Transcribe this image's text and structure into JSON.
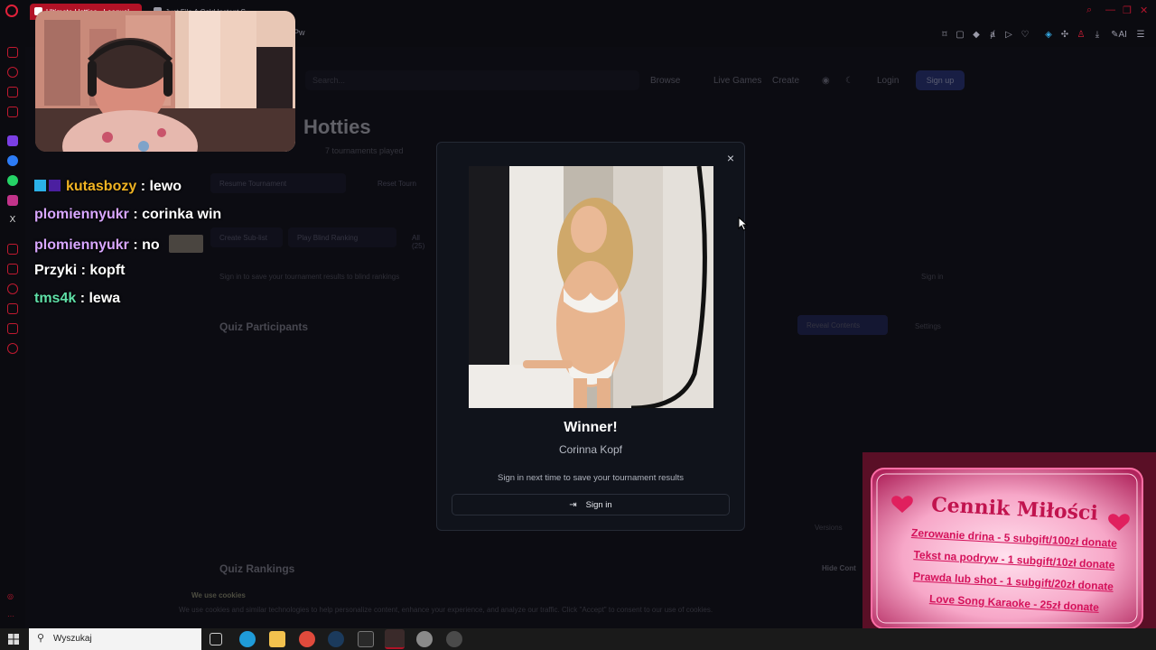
{
  "browser": {
    "tabs": [
      {
        "title": "Ultimate Hotties - Leaguel"
      },
      {
        "title": "Just File A Cold Instant S"
      }
    ],
    "url_fragment": "pPw"
  },
  "site": {
    "search_placeholder": "Search...",
    "nav": {
      "browse": "Browse",
      "live_games": "Live Games",
      "create": "Create",
      "login": "Login",
      "signup": "Sign up"
    },
    "title": "Hotties",
    "subtitle": "7 tournaments played",
    "buttons": {
      "resume": "Resume Tournament",
      "reset": "Reset Tourn",
      "create_list": "Create Sub-list",
      "play_ranking": "Play Blind Ranking",
      "all": "All (25)"
    },
    "signin_hint": "Sign in to save your tournament results to blind rankings",
    "signin_link": "Sign in",
    "sections": {
      "participants": "Quiz Participants",
      "rankings": "Quiz Rankings"
    },
    "reveal_btn": "Reveal Contents",
    "settings": "Settings",
    "hide": "Hide Cont",
    "versions": "Versions",
    "cookie_title": "We use cookies",
    "cookie_text": "We use cookies and similar technologies to help personalize content, enhance your experience, and analyze our traffic. Click \"Accept\" to consent to our use of cookies."
  },
  "modal": {
    "title": "Winner!",
    "name": "Corinna Kopf",
    "note": "Sign in next time to save your tournament results",
    "signin_label": "Sign in"
  },
  "chat": [
    {
      "user": "kutasbozy",
      "message": ": lewo",
      "color": "#f0b323"
    },
    {
      "user": "plomiennyukr",
      "message": ": corinka win",
      "color": "#d8a6ff"
    },
    {
      "user": "plomiennyukr",
      "message": ": no",
      "color": "#d8a6ff"
    },
    {
      "user": "Przyki",
      "message": ": kopft",
      "color": "#ffffff"
    },
    {
      "user": "tms4k",
      "message": ": lewa",
      "color": "#5fe0a8"
    }
  ],
  "pricelist": {
    "title": "Cennik Miłości",
    "items": [
      "Zerowanie drina - 5 subgift/100zł donate",
      "Tekst na podryw - 1 subgift/10zł donate",
      "Prawda lub shot - 1 subgift/20zł donate",
      "Love Song Karaoke - 25zł donate"
    ]
  },
  "taskbar": {
    "search_placeholder": "Wyszukaj"
  },
  "colors": {
    "accent_red": "#b11226",
    "modal_bg": "#10131b",
    "price_pink": "#ff3c9a"
  }
}
